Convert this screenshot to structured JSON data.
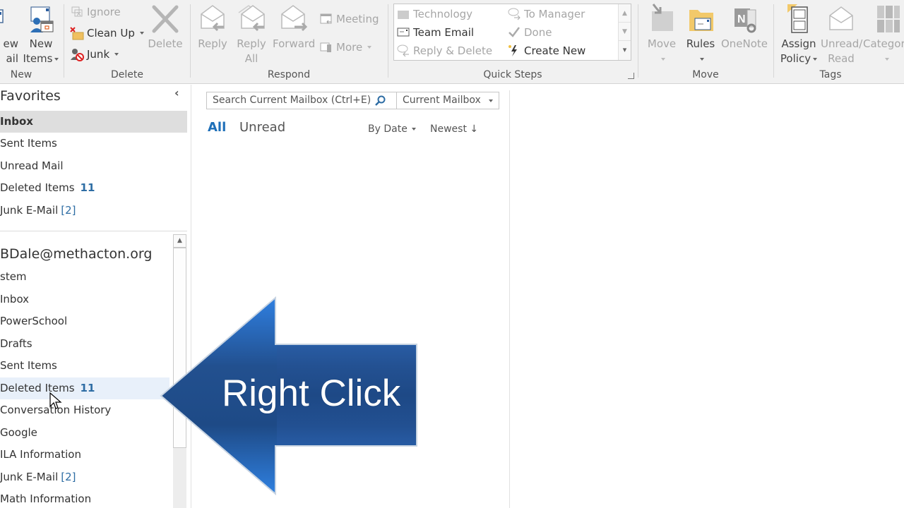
{
  "ribbon": {
    "groups": {
      "new": {
        "label": "New",
        "new_email": {
          "line1": "New",
          "line2": "Email",
          "visible_line1": "ew",
          "visible_line2": "ail"
        },
        "new_items": {
          "line1": "New",
          "line2": "Items"
        }
      },
      "delete": {
        "label": "Delete",
        "ignore": "Ignore",
        "clean_up": "Clean Up",
        "junk": "Junk",
        "delete": "Delete"
      },
      "respond": {
        "label": "Respond",
        "reply": "Reply",
        "reply_all_line1": "Reply",
        "reply_all_line2": "All",
        "forward": "Forward",
        "meeting": "Meeting",
        "more": "More"
      },
      "quick_steps": {
        "label": "Quick Steps",
        "items": [
          {
            "label": "Technology",
            "enabled": false
          },
          {
            "label": "To Manager",
            "enabled": false
          },
          {
            "label": "Team Email",
            "enabled": true
          },
          {
            "label": "Done",
            "enabled": false
          },
          {
            "label": "Reply & Delete",
            "enabled": false
          },
          {
            "label": "Create New",
            "enabled": true
          }
        ]
      },
      "move": {
        "label": "Move",
        "move": "Move",
        "rules": "Rules",
        "onenote": "OneNote"
      },
      "tags": {
        "label": "Tags",
        "assign_policy_line1": "Assign",
        "assign_policy_line2": "Policy",
        "unread_read_line1": "Unread/",
        "unread_read_line2": "Read",
        "categorize": "Categor"
      }
    }
  },
  "folder_pane": {
    "favorites_header": "Favorites",
    "collapse_glyph": "‹",
    "favorites": [
      {
        "label": "Inbox",
        "selected": true
      },
      {
        "label": "Sent Items"
      },
      {
        "label": "Unread Mail"
      },
      {
        "label": "Deleted Items",
        "count": "11"
      },
      {
        "label": "Junk E-Mail",
        "bracket": "[2]"
      }
    ],
    "account": "BDale@methacton.org",
    "folders": [
      {
        "label": "stem"
      },
      {
        "label": "Inbox"
      },
      {
        "label": "PowerSchool"
      },
      {
        "label": "Drafts"
      },
      {
        "label": "Sent Items"
      },
      {
        "label": "Deleted Items",
        "count": "11",
        "hover": true
      },
      {
        "label": "Conversation History"
      },
      {
        "label": "Google"
      },
      {
        "label": "ILA Information"
      },
      {
        "label": "Junk E-Mail",
        "bracket": "[2]"
      },
      {
        "label": "Math Information"
      }
    ]
  },
  "message_list": {
    "search_placeholder": "Search Current Mailbox (Ctrl+E)",
    "scope": "Current Mailbox",
    "filters": {
      "all": "All",
      "unread": "Unread"
    },
    "sort_by": "By Date",
    "sort_order": "Newest ↓"
  },
  "overlay": {
    "arrow_text": "Right Click",
    "arrow_color": "#1f4e8c"
  }
}
